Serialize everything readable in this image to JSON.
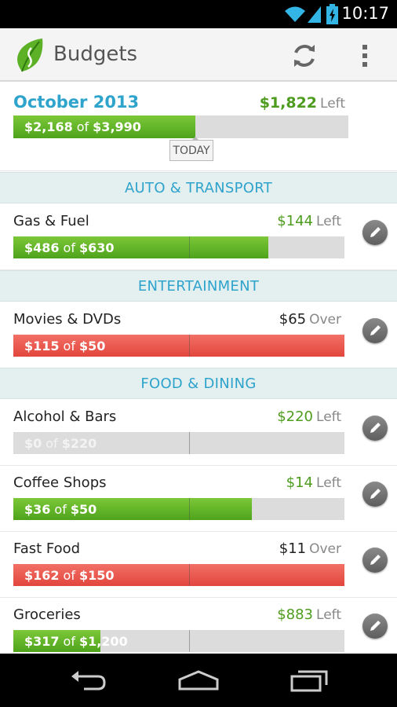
{
  "status_bar": {
    "time": "10:17"
  },
  "action_bar": {
    "title": "Budgets"
  },
  "summary": {
    "month": "October 2013",
    "left_amount": "$1,822",
    "left_word": "Left",
    "spent": "$2,168",
    "of_word": "of",
    "budget": "$3,990",
    "progress": 0.543,
    "today_label": "TODAY",
    "today_fraction": 0.54
  },
  "categories": [
    {
      "title": "AUTO & TRANSPORT"
    },
    {
      "title": "ENTERTAINMENT"
    },
    {
      "title": "FOOD & DINING"
    }
  ],
  "budgets": [
    {
      "name": "Gas & Fuel",
      "amount": "$144",
      "status": "Left",
      "spent": "$486",
      "of_word": "of",
      "budget": "$630",
      "progress": 0.771,
      "color": "green"
    },
    {
      "name": "Movies & DVDs",
      "amount": "$65",
      "status": "Over",
      "spent": "$115",
      "of_word": "of",
      "budget": "$50",
      "progress": 1.0,
      "color": "red"
    },
    {
      "name": "Alcohol & Bars",
      "amount": "$220",
      "status": "Left",
      "spent": "$0",
      "of_word": "of",
      "budget": "$220",
      "progress": 0.0,
      "color": "none"
    },
    {
      "name": "Coffee Shops",
      "amount": "$14",
      "status": "Left",
      "spent": "$36",
      "of_word": "of",
      "budget": "$50",
      "progress": 0.72,
      "color": "green"
    },
    {
      "name": "Fast Food",
      "amount": "$11",
      "status": "Over",
      "spent": "$162",
      "of_word": "of",
      "budget": "$150",
      "progress": 1.0,
      "color": "red"
    },
    {
      "name": "Groceries",
      "amount": "$883",
      "status": "Left",
      "spent": "$317",
      "of_word": "of",
      "budget": "$1,200",
      "progress": 0.264,
      "color": "green"
    }
  ],
  "icons": {
    "refresh": "refresh-icon",
    "overflow": "overflow-menu-icon",
    "edit": "pencil-icon",
    "back": "back-icon",
    "home": "home-icon",
    "recents": "recent-apps-icon"
  },
  "colors": {
    "accent_blue": "#2ea3cc",
    "left_green": "#4d9c1e",
    "bar_green": "#5cb126",
    "bar_red": "#e8544a",
    "category_bg": "#e4eff0"
  }
}
